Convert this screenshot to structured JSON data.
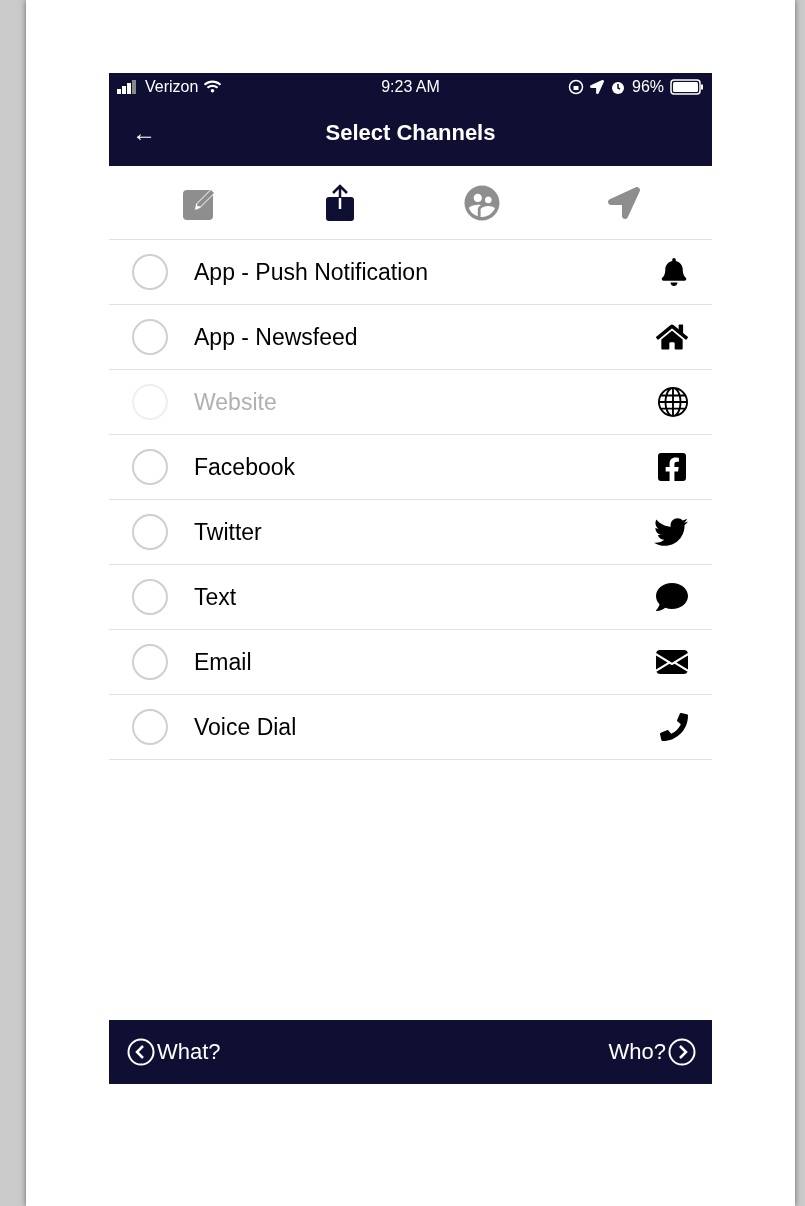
{
  "status_bar": {
    "carrier": "Verizon",
    "time": "9:23 AM",
    "battery": "96%"
  },
  "nav": {
    "back": "←",
    "title": "Select Channels"
  },
  "steps": [
    {
      "selected": false
    },
    {
      "selected": true
    },
    {
      "selected": false
    },
    {
      "selected": false
    }
  ],
  "channels": [
    {
      "label": "App - Push Notification",
      "checked": false,
      "disabled": false
    },
    {
      "label": "App - Newsfeed",
      "checked": false,
      "disabled": false
    },
    {
      "label": "Website",
      "checked": false,
      "disabled": true
    },
    {
      "label": "Facebook",
      "checked": false,
      "disabled": false
    },
    {
      "label": "Twitter",
      "checked": false,
      "disabled": false
    },
    {
      "label": "Text",
      "checked": false,
      "disabled": false
    },
    {
      "label": "Email",
      "checked": false,
      "disabled": false
    },
    {
      "label": "Voice Dial",
      "checked": false,
      "disabled": false
    }
  ],
  "footer": {
    "back": "What?",
    "next": "Who?"
  }
}
